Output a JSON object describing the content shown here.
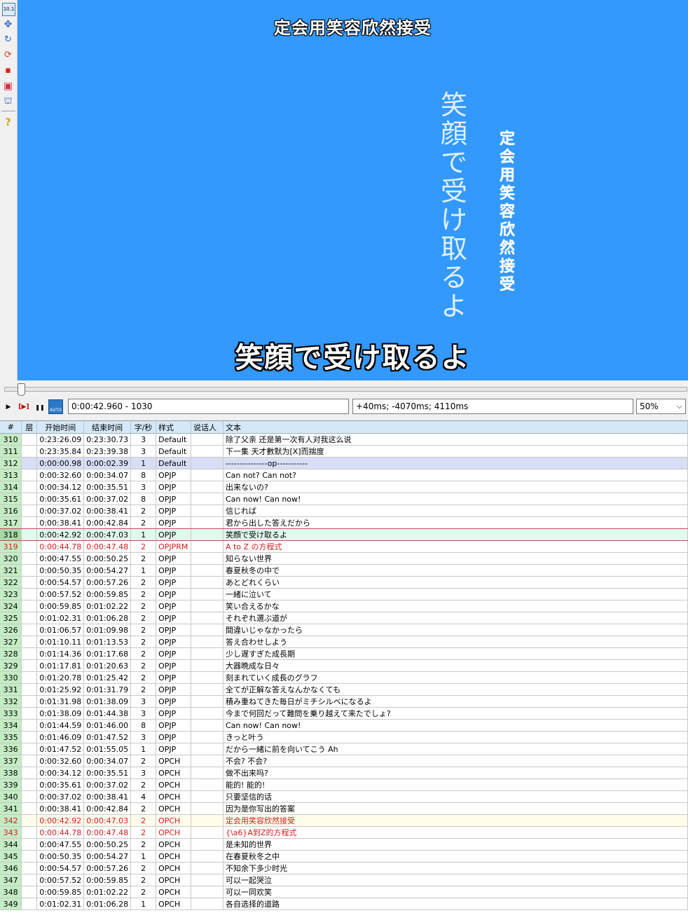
{
  "toolbar": {
    "tools": [
      {
        "icon": "standard-tool-icon",
        "glyph": "10.1"
      },
      {
        "icon": "drag-move-icon",
        "glyph": "✥"
      },
      {
        "icon": "rotate-z-icon",
        "glyph": "↻"
      },
      {
        "icon": "rotate-xy-icon",
        "glyph": "⟳"
      },
      {
        "icon": "scale-icon",
        "glyph": "▪"
      },
      {
        "icon": "clip-icon",
        "glyph": "▣"
      },
      {
        "icon": "vector-clip-icon",
        "glyph": "⛫"
      },
      {
        "icon": "help-icon",
        "glyph": "?"
      }
    ]
  },
  "video": {
    "bg_color": "#3399ff",
    "top_subtitle": "定会用笑容欣然接受",
    "vertical_jp": [
      "笑",
      "顔",
      "で",
      "受",
      "け",
      "取",
      "る",
      "よ"
    ],
    "vertical_cn": [
      "定",
      "会",
      "用",
      "笑",
      "容",
      "欣",
      "然",
      "接",
      "受"
    ],
    "bottom_subtitle": "笑顔で受け取るよ"
  },
  "seek": {
    "position_fraction": 0.02
  },
  "controls": {
    "play_glyph": "▶",
    "play_line_glyph": "[▶]",
    "pause_glyph": "❚❚",
    "auto_label": "AUTO",
    "time_frame": "0:00:42.960 - 1030",
    "offsets": "+40ms; -4070ms; 4110ms",
    "zoom": "50%",
    "zoom_arrow": "⌵"
  },
  "grid": {
    "headers": [
      "#",
      "层",
      "开始时间",
      "结束时间",
      "字/秒",
      "样式",
      "说话人",
      "文本"
    ],
    "rows": [
      [
        "310",
        "",
        "0:23:26.09",
        "0:23:30.73",
        "3",
        "Default",
        "",
        "除了父亲 还是第一次有人对我这么说"
      ],
      [
        "311",
        "",
        "0:23:35.84",
        "0:23:39.38",
        "3",
        "Default",
        "",
        "下一集 天才數默为[X]而揣度"
      ],
      [
        "312",
        "",
        "0:00:00.98",
        "0:00:02.39",
        "1",
        "Default",
        "",
        "---------------op-----------"
      ],
      [
        "313",
        "",
        "0:00:32.60",
        "0:00:34.07",
        "8",
        "OPJP",
        "",
        "Can not? Can not?"
      ],
      [
        "314",
        "",
        "0:00:34.12",
        "0:00:35.51",
        "3",
        "OPJP",
        "",
        "出来ないの?"
      ],
      [
        "315",
        "",
        "0:00:35.61",
        "0:00:37.02",
        "8",
        "OPJP",
        "",
        "Can now! Can now!"
      ],
      [
        "316",
        "",
        "0:00:37.02",
        "0:00:38.41",
        "2",
        "OPJP",
        "",
        "信じれば"
      ],
      [
        "317",
        "",
        "0:00:38.41",
        "0:00:42.84",
        "2",
        "OPJP",
        "",
        "君から出した答えだから"
      ],
      [
        "318",
        "",
        "0:00:42.92",
        "0:00:47.03",
        "1",
        "OPJP",
        "",
        "笑顔で受け取るよ"
      ],
      [
        "319",
        "",
        "0:00:44.78",
        "0:00:47.48",
        "2",
        "OPJPRM",
        "",
        "A to Z の方程式"
      ],
      [
        "320",
        "",
        "0:00:47.55",
        "0:00:50.25",
        "2",
        "OPJP",
        "",
        "知らない世界"
      ],
      [
        "321",
        "",
        "0:00:50.35",
        "0:00:54.27",
        "1",
        "OPJP",
        "",
        "春夏秋冬の中で"
      ],
      [
        "322",
        "",
        "0:00:54.57",
        "0:00:57.26",
        "2",
        "OPJP",
        "",
        "あとどれくらい"
      ],
      [
        "323",
        "",
        "0:00:57.52",
        "0:00:59.85",
        "2",
        "OPJP",
        "",
        "一緒に泣いて"
      ],
      [
        "324",
        "",
        "0:00:59.85",
        "0:01:02.22",
        "2",
        "OPJP",
        "",
        "笑い合えるかな"
      ],
      [
        "325",
        "",
        "0:01:02.31",
        "0:01:06.28",
        "2",
        "OPJP",
        "",
        "それぞれ選ぶ道が"
      ],
      [
        "326",
        "",
        "0:01:06.57",
        "0:01:09.98",
        "2",
        "OPJP",
        "",
        "間違いじゃなかったら"
      ],
      [
        "327",
        "",
        "0:01:10.11",
        "0:01:13.53",
        "2",
        "OPJP",
        "",
        "答え合わせしよう"
      ],
      [
        "328",
        "",
        "0:01:14.36",
        "0:01:17.68",
        "2",
        "OPJP",
        "",
        "少し遅すぎた成長期"
      ],
      [
        "329",
        "",
        "0:01:17.81",
        "0:01:20.63",
        "2",
        "OPJP",
        "",
        "大器晩成な日々"
      ],
      [
        "330",
        "",
        "0:01:20.78",
        "0:01:25.42",
        "2",
        "OPJP",
        "",
        "刻まれていく成長のグラフ"
      ],
      [
        "331",
        "",
        "0:01:25.92",
        "0:01:31.79",
        "2",
        "OPJP",
        "",
        "全てが正解な答えなんかなくても"
      ],
      [
        "332",
        "",
        "0:01:31.98",
        "0:01:38.09",
        "3",
        "OPJP",
        "",
        "積み重ねてきた毎日がミチシルベになるよ"
      ],
      [
        "333",
        "",
        "0:01:38.09",
        "0:01:44.38",
        "3",
        "OPJP",
        "",
        "今まで何回だって難問を乗り越えて来たでしょ?"
      ],
      [
        "334",
        "",
        "0:01:44.59",
        "0:01:46.00",
        "8",
        "OPJP",
        "",
        "Can now! Can now!"
      ],
      [
        "335",
        "",
        "0:01:46.09",
        "0:01:47.52",
        "3",
        "OPJP",
        "",
        "きっと叶う"
      ],
      [
        "336",
        "",
        "0:01:47.52",
        "0:01:55.05",
        "1",
        "OPJP",
        "",
        "だから一緒に前を向いてこう    Ah"
      ],
      [
        "337",
        "",
        "0:00:32.60",
        "0:00:34.07",
        "2",
        "OPCH",
        "",
        "不会? 不会?"
      ],
      [
        "338",
        "",
        "0:00:34.12",
        "0:00:35.51",
        "3",
        "OPCH",
        "",
        "做不出来吗?"
      ],
      [
        "339",
        "",
        "0:00:35.61",
        "0:00:37.02",
        "2",
        "OPCH",
        "",
        "能的! 能的!"
      ],
      [
        "340",
        "",
        "0:00:37.02",
        "0:00:38.41",
        "4",
        "OPCH",
        "",
        "只要坚信的话"
      ],
      [
        "341",
        "",
        "0:00:38.41",
        "0:00:42.84",
        "2",
        "OPCH",
        "",
        "因为是你写出的答案"
      ],
      [
        "342",
        "",
        "0:00:42.92",
        "0:00:47.03",
        "2",
        "OPCH",
        "",
        "定会用笑容欣然接受"
      ],
      [
        "343",
        "",
        "0:00:44.78",
        "0:00:47.48",
        "2",
        "OPCH",
        "",
        "{\\a6}A到Z的方程式"
      ],
      [
        "344",
        "",
        "0:00:47.55",
        "0:00:50.25",
        "2",
        "OPCH",
        "",
        "是未知的世界"
      ],
      [
        "345",
        "",
        "0:00:50.35",
        "0:00:54.27",
        "1",
        "OPCH",
        "",
        "在春夏秋冬之中"
      ],
      [
        "346",
        "",
        "0:00:54.57",
        "0:00:57.26",
        "2",
        "OPCH",
        "",
        "不知余下多少时光"
      ],
      [
        "347",
        "",
        "0:00:57.52",
        "0:00:59.85",
        "2",
        "OPCH",
        "",
        "可以一起哭泣"
      ],
      [
        "348",
        "",
        "0:00:59.85",
        "0:01:02.22",
        "2",
        "OPCH",
        "",
        "可以一同欢笑"
      ],
      [
        "349",
        "",
        "0:01:02.31",
        "0:01:06.28",
        "1",
        "OPCH",
        "",
        "各自选择的道路"
      ]
    ]
  }
}
